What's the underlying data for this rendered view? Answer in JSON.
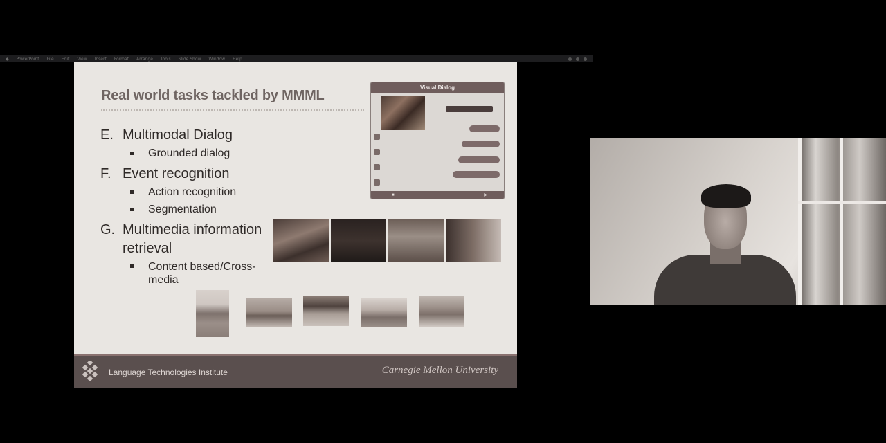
{
  "menubar": {
    "items": [
      "PowerPoint",
      "File",
      "Edit",
      "View",
      "Insert",
      "Format",
      "Arrange",
      "Tools",
      "Slide Show",
      "Window",
      "Help"
    ]
  },
  "slide": {
    "title": "Real world tasks tackled by MMML",
    "sections": [
      {
        "letter": "E.",
        "heading": "Multimodal Dialog",
        "subs": [
          "Grounded dialog"
        ]
      },
      {
        "letter": "F.",
        "heading": "Event recognition",
        "subs": [
          "Action recognition",
          "Segmentation"
        ]
      },
      {
        "letter": "G.",
        "heading": "Multimedia information",
        "heading_line2": "retrieval",
        "subs_multiline": [
          "Content based/Cross-",
          "media"
        ]
      }
    ],
    "visual_dialog": {
      "title": "Visual Dialog"
    },
    "footer": {
      "institute": "Language Technologies Institute",
      "university": "Carnegie Mellon University"
    }
  },
  "colors": {
    "slide_bg": "#e9e6e2",
    "title": "#6f6562",
    "footer_bg": "#5a4f4e",
    "accent": "#6f5d5c"
  },
  "icons": [
    "lti-logo-icon",
    "play-icon",
    "chat-avatar-icon"
  ]
}
